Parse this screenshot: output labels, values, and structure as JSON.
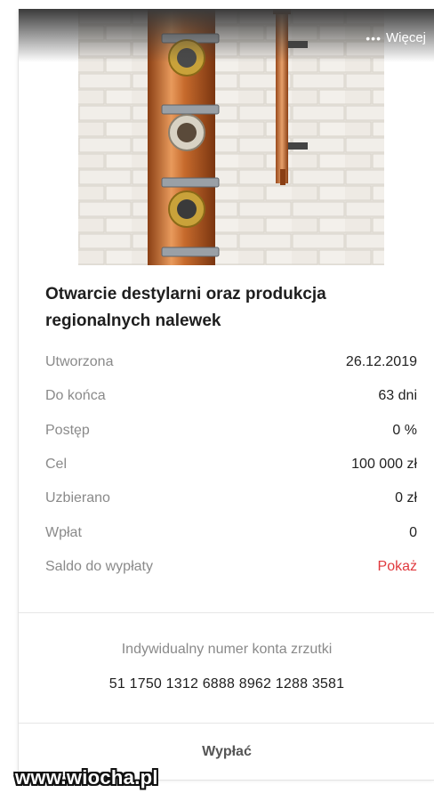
{
  "header": {
    "more_label": "Więcej"
  },
  "campaign": {
    "title": "Otwarcie destylarni oraz produkcja regionalnych nalewek"
  },
  "details": [
    {
      "label": "Utworzona",
      "value": "26.12.2019"
    },
    {
      "label": "Do końca",
      "value": "63 dni"
    },
    {
      "label": "Postęp",
      "value": "0 %"
    },
    {
      "label": "Cel",
      "value": "100 000 zł"
    },
    {
      "label": "Uzbierano",
      "value": "0 zł"
    },
    {
      "label": "Wpłat",
      "value": "0"
    },
    {
      "label": "Saldo do wypłaty",
      "value": "Pokaż"
    }
  ],
  "account": {
    "label": "Indywidualny numer konta zrzutki",
    "number": "51 1750 1312 6888 8962 1288 3581"
  },
  "actions": {
    "payout_label": "Wypłać"
  },
  "watermark": "www.wiocha.pl",
  "colors": {
    "accent": "#e0393e",
    "muted": "#8a8a8a",
    "text": "#1e1e1e"
  },
  "icons": {
    "more": "ellipsis-icon"
  }
}
